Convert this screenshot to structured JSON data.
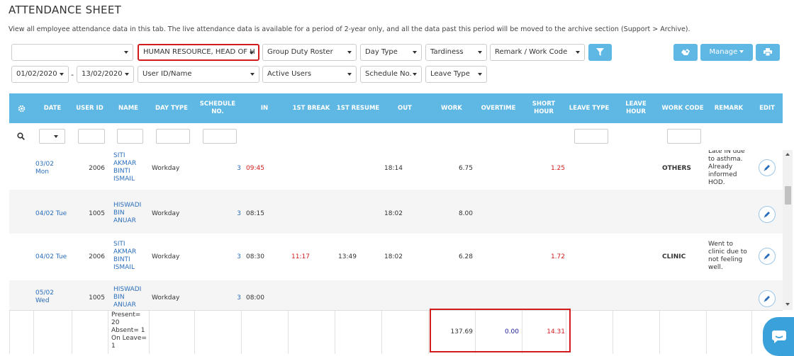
{
  "page": {
    "title": "ATTENDANCE SHEET",
    "description": "View all employee attendance data in this tab. The live attendance data is available for a period of 2-year only, and all the data past this period will be moved to the archive section (Support > Archive)."
  },
  "filters": {
    "company": "",
    "department": "HUMAN RESOURCE, HEAD OF H",
    "group": "Group Duty Roster",
    "day_type": "Day Type",
    "tardiness": "Tardiness",
    "remark_code": "Remark / Work Code",
    "date_from": "01/02/2020",
    "date_sep": "-",
    "date_to": "13/02/2020",
    "user": "User ID/Name",
    "user_status": "Active Users",
    "schedule": "Schedule No.",
    "leave_type": "Leave Type",
    "manage_label": "Manage"
  },
  "table": {
    "columns": [
      "DATE",
      "USER ID",
      "NAME",
      "DAY TYPE",
      "SCHEDULE NO.",
      "IN",
      "1ST BREAK",
      "1ST RESUME",
      "OUT",
      "WORK",
      "OVERTIME",
      "SHORT HOUR",
      "LEAVE TYPE",
      "LEAVE HOUR",
      "WORK CODE",
      "REMARK",
      "EDIT"
    ],
    "rows": [
      {
        "date": "03/02 Mon",
        "user_id": "2006",
        "name": "SITI AKMAR BINTI ISMAIL",
        "day_type": "Workday",
        "schedule": "3",
        "in": "09:45",
        "break1": "",
        "resume1": "",
        "out": "18:14",
        "work": "6.75",
        "overtime": "",
        "short": "1.25",
        "leave_type": "",
        "leave_hour": "",
        "work_code": "OTHERS",
        "remark": "Late IN due to asthma. Already informed HOD."
      },
      {
        "date": "04/02 Tue",
        "user_id": "1005",
        "name": "HISWADI BIN ANUAR",
        "day_type": "Workday",
        "schedule": "3",
        "in": "08:15",
        "break1": "",
        "resume1": "",
        "out": "18:02",
        "work": "8.00",
        "overtime": "",
        "short": "",
        "leave_type": "",
        "leave_hour": "",
        "work_code": "",
        "remark": ""
      },
      {
        "date": "04/02 Tue",
        "user_id": "2006",
        "name": "SITI AKMAR BINTI ISMAIL",
        "day_type": "Workday",
        "schedule": "3",
        "in": "08:30",
        "break1": "11:17",
        "resume1": "13:49",
        "out": "18:02",
        "work": "6.28",
        "overtime": "",
        "short": "1.72",
        "leave_type": "",
        "leave_hour": "",
        "work_code": "CLINIC",
        "remark": "Went to clinic due to not feeling well."
      },
      {
        "date": "05/02 Wed",
        "user_id": "1005",
        "name": "HISWADI BIN ANUAR",
        "day_type": "Workday",
        "schedule": "3",
        "in": "08:00",
        "break1": "",
        "resume1": "",
        "out": "",
        "work": "",
        "overtime": "",
        "short": "",
        "leave_type": "",
        "leave_hour": "",
        "work_code": "",
        "remark": ""
      }
    ],
    "summary": {
      "counts": "Present= 20 Absent= 1 On Leave= 1",
      "work": "137.69",
      "overtime": "0.00",
      "short": "14.31"
    }
  },
  "colors": {
    "accent": "#5fb7e3",
    "highlight": "#d21b1b",
    "link": "#2a6ebb"
  }
}
